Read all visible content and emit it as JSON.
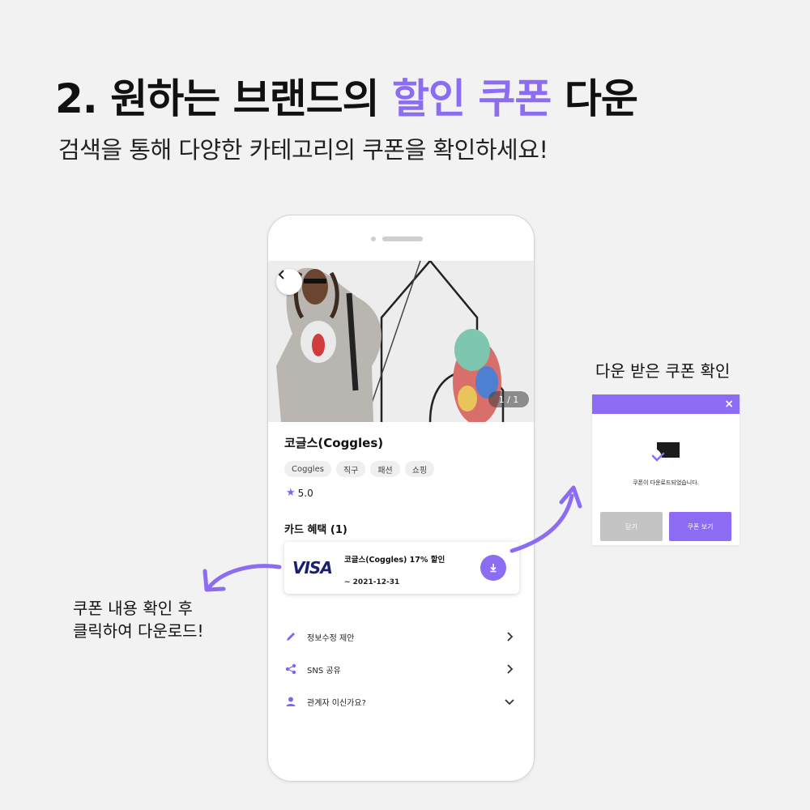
{
  "headline": {
    "prefix": "2. 원하는 브랜드의 ",
    "accent": "할인 쿠폰",
    "suffix": " 다운"
  },
  "subline": "검색을 통해 다양한 카테고리의 쿠폰을 확인하세요!",
  "colors": {
    "accent": "#8b6cf3",
    "visa": "#1a1f71"
  },
  "phone": {
    "pager": "1 / 1",
    "brand_name": "코글스(Coggles)",
    "tags": [
      "Coggles",
      "직구",
      "패션",
      "쇼핑"
    ],
    "rating": "5.0",
    "section_title": "카드 혜택 (1)",
    "benefit": {
      "card_logo": "VISA",
      "title": "코글스(Coggles) 17% 할인",
      "date": "~ 2021-12-31"
    },
    "menu": [
      {
        "label": "정보수정 제안",
        "icon": "pencil-icon",
        "chevron": "chevron-right-icon"
      },
      {
        "label": "SNS 공유",
        "icon": "share-icon",
        "chevron": "chevron-right-icon"
      },
      {
        "label": "관계자 이신가요?",
        "icon": "person-icon",
        "chevron": "chevron-down-icon"
      }
    ]
  },
  "note_right": "다운 받은 쿠폰 확인",
  "note_left": [
    "쿠폰 내용 확인 후",
    "클릭하여 다운로드!"
  ],
  "dialog": {
    "close_icon": "×",
    "message": "쿠폰이 다운로드되었습니다.",
    "close_label": "닫기",
    "view_label": "쿠폰 보기"
  }
}
